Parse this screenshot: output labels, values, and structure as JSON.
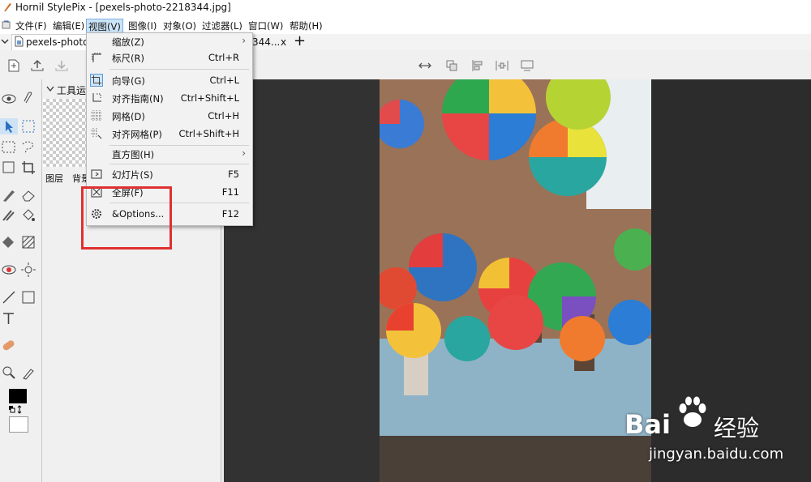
{
  "window": {
    "title": "Hornil StylePix - [pexels-photo-2218344.jpg]"
  },
  "menubar": {
    "items": [
      "文件(F)",
      "编辑(E)",
      "视图(V)",
      "图像(I)",
      "对象(O)",
      "过滤器(L)",
      "窗口(W)",
      "帮助(H)"
    ],
    "active": "视图(V)"
  },
  "tabs": {
    "doc_label": "pexels-photo",
    "doc_label_tail": "344...",
    "close": "x",
    "new": "+"
  },
  "layers_panel": {
    "title": "工具运",
    "tab_layers": "图层",
    "tab_bg": "背景"
  },
  "view_menu": {
    "items": [
      {
        "label": "缩放(Z)",
        "shortcut": "",
        "icon": "none",
        "submenu": true
      },
      {
        "label": "标尺(R)",
        "shortcut": "Ctrl+R",
        "icon": "ruler-icon",
        "submenu": false
      },
      {
        "label": "向导(G)",
        "shortcut": "Ctrl+L",
        "icon": "guide-icon",
        "submenu": false,
        "checked": true
      },
      {
        "label": "对齐指南(N)",
        "shortcut": "Ctrl+Shift+L",
        "icon": "snap-guide-icon",
        "submenu": false
      },
      {
        "label": "网格(D)",
        "shortcut": "Ctrl+H",
        "icon": "grid-icon",
        "submenu": false
      },
      {
        "label": "对齐网格(P)",
        "shortcut": "Ctrl+Shift+H",
        "icon": "snap-grid-icon",
        "submenu": false
      },
      {
        "label": "直方图(H)",
        "shortcut": "",
        "icon": "none",
        "submenu": true
      },
      {
        "label": "幻灯片(S)",
        "shortcut": "F5",
        "icon": "slideshow-icon",
        "submenu": false
      },
      {
        "label": "全屏(F)",
        "shortcut": "F11",
        "icon": "fullscreen-icon",
        "submenu": false
      },
      {
        "label": "&Options...",
        "shortcut": "F12",
        "icon": "gear-icon",
        "submenu": false
      }
    ],
    "submenu_arrow": "›"
  },
  "annotation": {
    "color": "#e03030"
  },
  "watermark": {
    "brand": "Bai",
    "sub": "经验",
    "url": "jingyan.baidu.com"
  },
  "colors": {
    "canvas_bg": "#323232",
    "menu_active": "#cce4f7",
    "photo_sky": "#eef2f4"
  }
}
